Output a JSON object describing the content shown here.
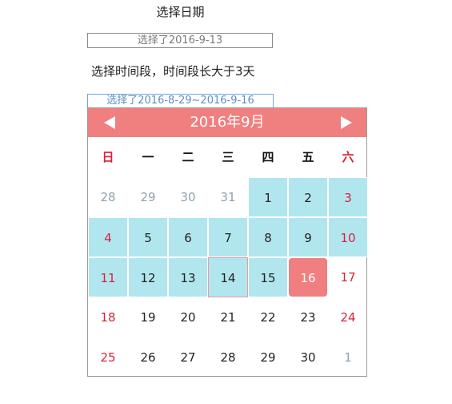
{
  "section1": {
    "title": "选择日期",
    "input_value": "选择了2016-9-13"
  },
  "section2": {
    "title": "选择时间段，时间段长大于3天",
    "input_value": "选择了2016-8-29~2016-9-16"
  },
  "calendar": {
    "title": "2016年9月",
    "prev_icon": "left-arrow",
    "next_icon": "right-arrow",
    "colors": {
      "header": "#f07f80",
      "range": "#b2e6ee",
      "weekend": "#d8233a",
      "other_month": "#8fa3ad"
    },
    "weekdays": [
      "日",
      "一",
      "二",
      "三",
      "四",
      "五",
      "六"
    ],
    "weeks": [
      [
        {
          "label": "28",
          "other": true,
          "range": false
        },
        {
          "label": "29",
          "other": true,
          "range": false
        },
        {
          "label": "30",
          "other": true,
          "range": false
        },
        {
          "label": "31",
          "other": true,
          "range": false
        },
        {
          "label": "1",
          "other": false,
          "range": true
        },
        {
          "label": "2",
          "other": false,
          "range": true
        },
        {
          "label": "3",
          "other": false,
          "range": true
        }
      ],
      [
        {
          "label": "4",
          "other": false,
          "range": true
        },
        {
          "label": "5",
          "other": false,
          "range": true
        },
        {
          "label": "6",
          "other": false,
          "range": true
        },
        {
          "label": "7",
          "other": false,
          "range": true
        },
        {
          "label": "8",
          "other": false,
          "range": true
        },
        {
          "label": "9",
          "other": false,
          "range": true
        },
        {
          "label": "10",
          "other": false,
          "range": true
        }
      ],
      [
        {
          "label": "11",
          "other": false,
          "range": true
        },
        {
          "label": "12",
          "other": false,
          "range": true
        },
        {
          "label": "13",
          "other": false,
          "range": true
        },
        {
          "label": "14",
          "other": false,
          "range": true,
          "today": true
        },
        {
          "label": "15",
          "other": false,
          "range": true
        },
        {
          "label": "16",
          "other": false,
          "range": false,
          "selected": true
        },
        {
          "label": "17",
          "other": false,
          "range": false
        }
      ],
      [
        {
          "label": "18",
          "other": false,
          "range": false
        },
        {
          "label": "19",
          "other": false,
          "range": false
        },
        {
          "label": "20",
          "other": false,
          "range": false
        },
        {
          "label": "21",
          "other": false,
          "range": false
        },
        {
          "label": "22",
          "other": false,
          "range": false
        },
        {
          "label": "23",
          "other": false,
          "range": false
        },
        {
          "label": "24",
          "other": false,
          "range": false
        }
      ],
      [
        {
          "label": "25",
          "other": false,
          "range": false
        },
        {
          "label": "26",
          "other": false,
          "range": false
        },
        {
          "label": "27",
          "other": false,
          "range": false
        },
        {
          "label": "28",
          "other": false,
          "range": false
        },
        {
          "label": "29",
          "other": false,
          "range": false
        },
        {
          "label": "30",
          "other": false,
          "range": false
        },
        {
          "label": "1",
          "other": true,
          "range": false
        }
      ]
    ]
  }
}
